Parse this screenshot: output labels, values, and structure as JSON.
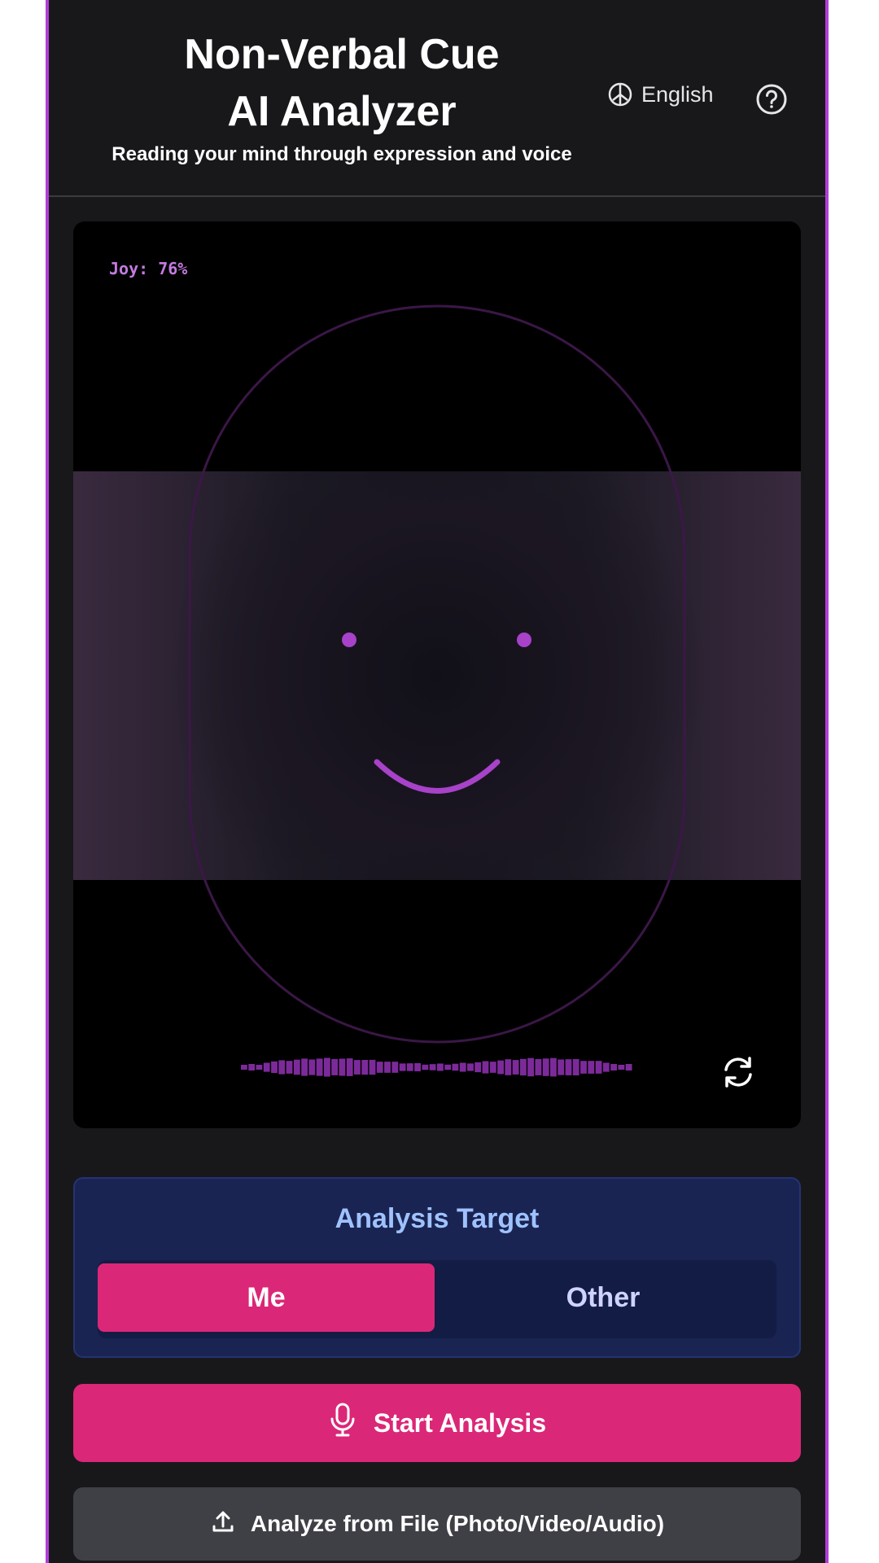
{
  "header": {
    "title_line1": "Non-Verbal Cue",
    "title_line2": "AI Analyzer",
    "subtitle": "Reading your mind through expression and voice",
    "language_label": "English",
    "globe_icon": "globe-icon",
    "help_icon": "help-circle-icon"
  },
  "camera": {
    "emotion_readout": "Joy: 76%",
    "switch_icon": "refresh-camera-icon"
  },
  "analysis_target": {
    "title": "Analysis Target",
    "options": [
      "Me",
      "Other"
    ],
    "selected": "Me"
  },
  "actions": {
    "start_label": "Start Analysis",
    "start_icon": "microphone-icon",
    "file_label": "Analyze from File (Photo/Video/Audio)",
    "file_icon": "upload-icon"
  },
  "colors": {
    "accent_pink": "#db2777",
    "frame_purple": "#b23ed8",
    "face_purple": "#a742c9",
    "target_bg": "#1a2452"
  }
}
